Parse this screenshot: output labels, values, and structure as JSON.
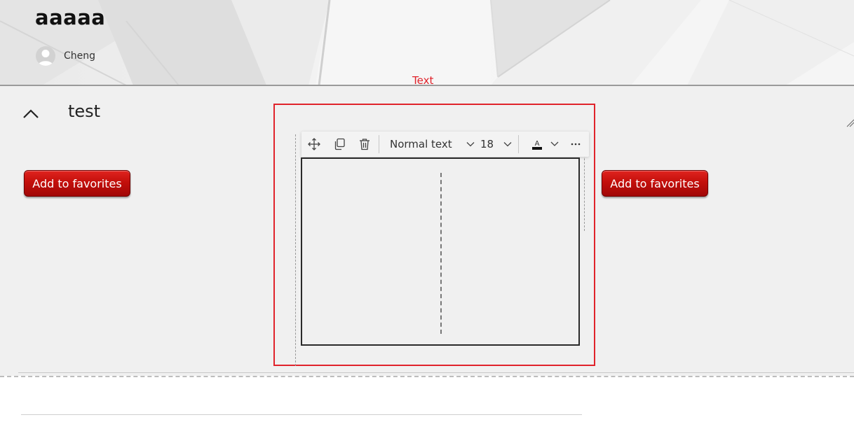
{
  "header": {
    "page_title": "aaaaa",
    "author_name": "Cheng"
  },
  "section": {
    "title": "test",
    "collapse_icon": "chevron-up-icon",
    "left_button_label": "Add to favorites",
    "right_button_label": "Add to favorites"
  },
  "text_webpart": {
    "label": "Text",
    "toolbar": {
      "move_icon": "move-icon",
      "duplicate_icon": "duplicate-icon",
      "delete_icon": "trash-icon",
      "text_style": "Normal text",
      "font_size": "18",
      "font_color_icon": "font-color-icon",
      "more_icon": "more-icon"
    }
  },
  "colors": {
    "selection": "#e0232b",
    "button": "#c30f0b",
    "section_bg": "#f0f0f0"
  }
}
